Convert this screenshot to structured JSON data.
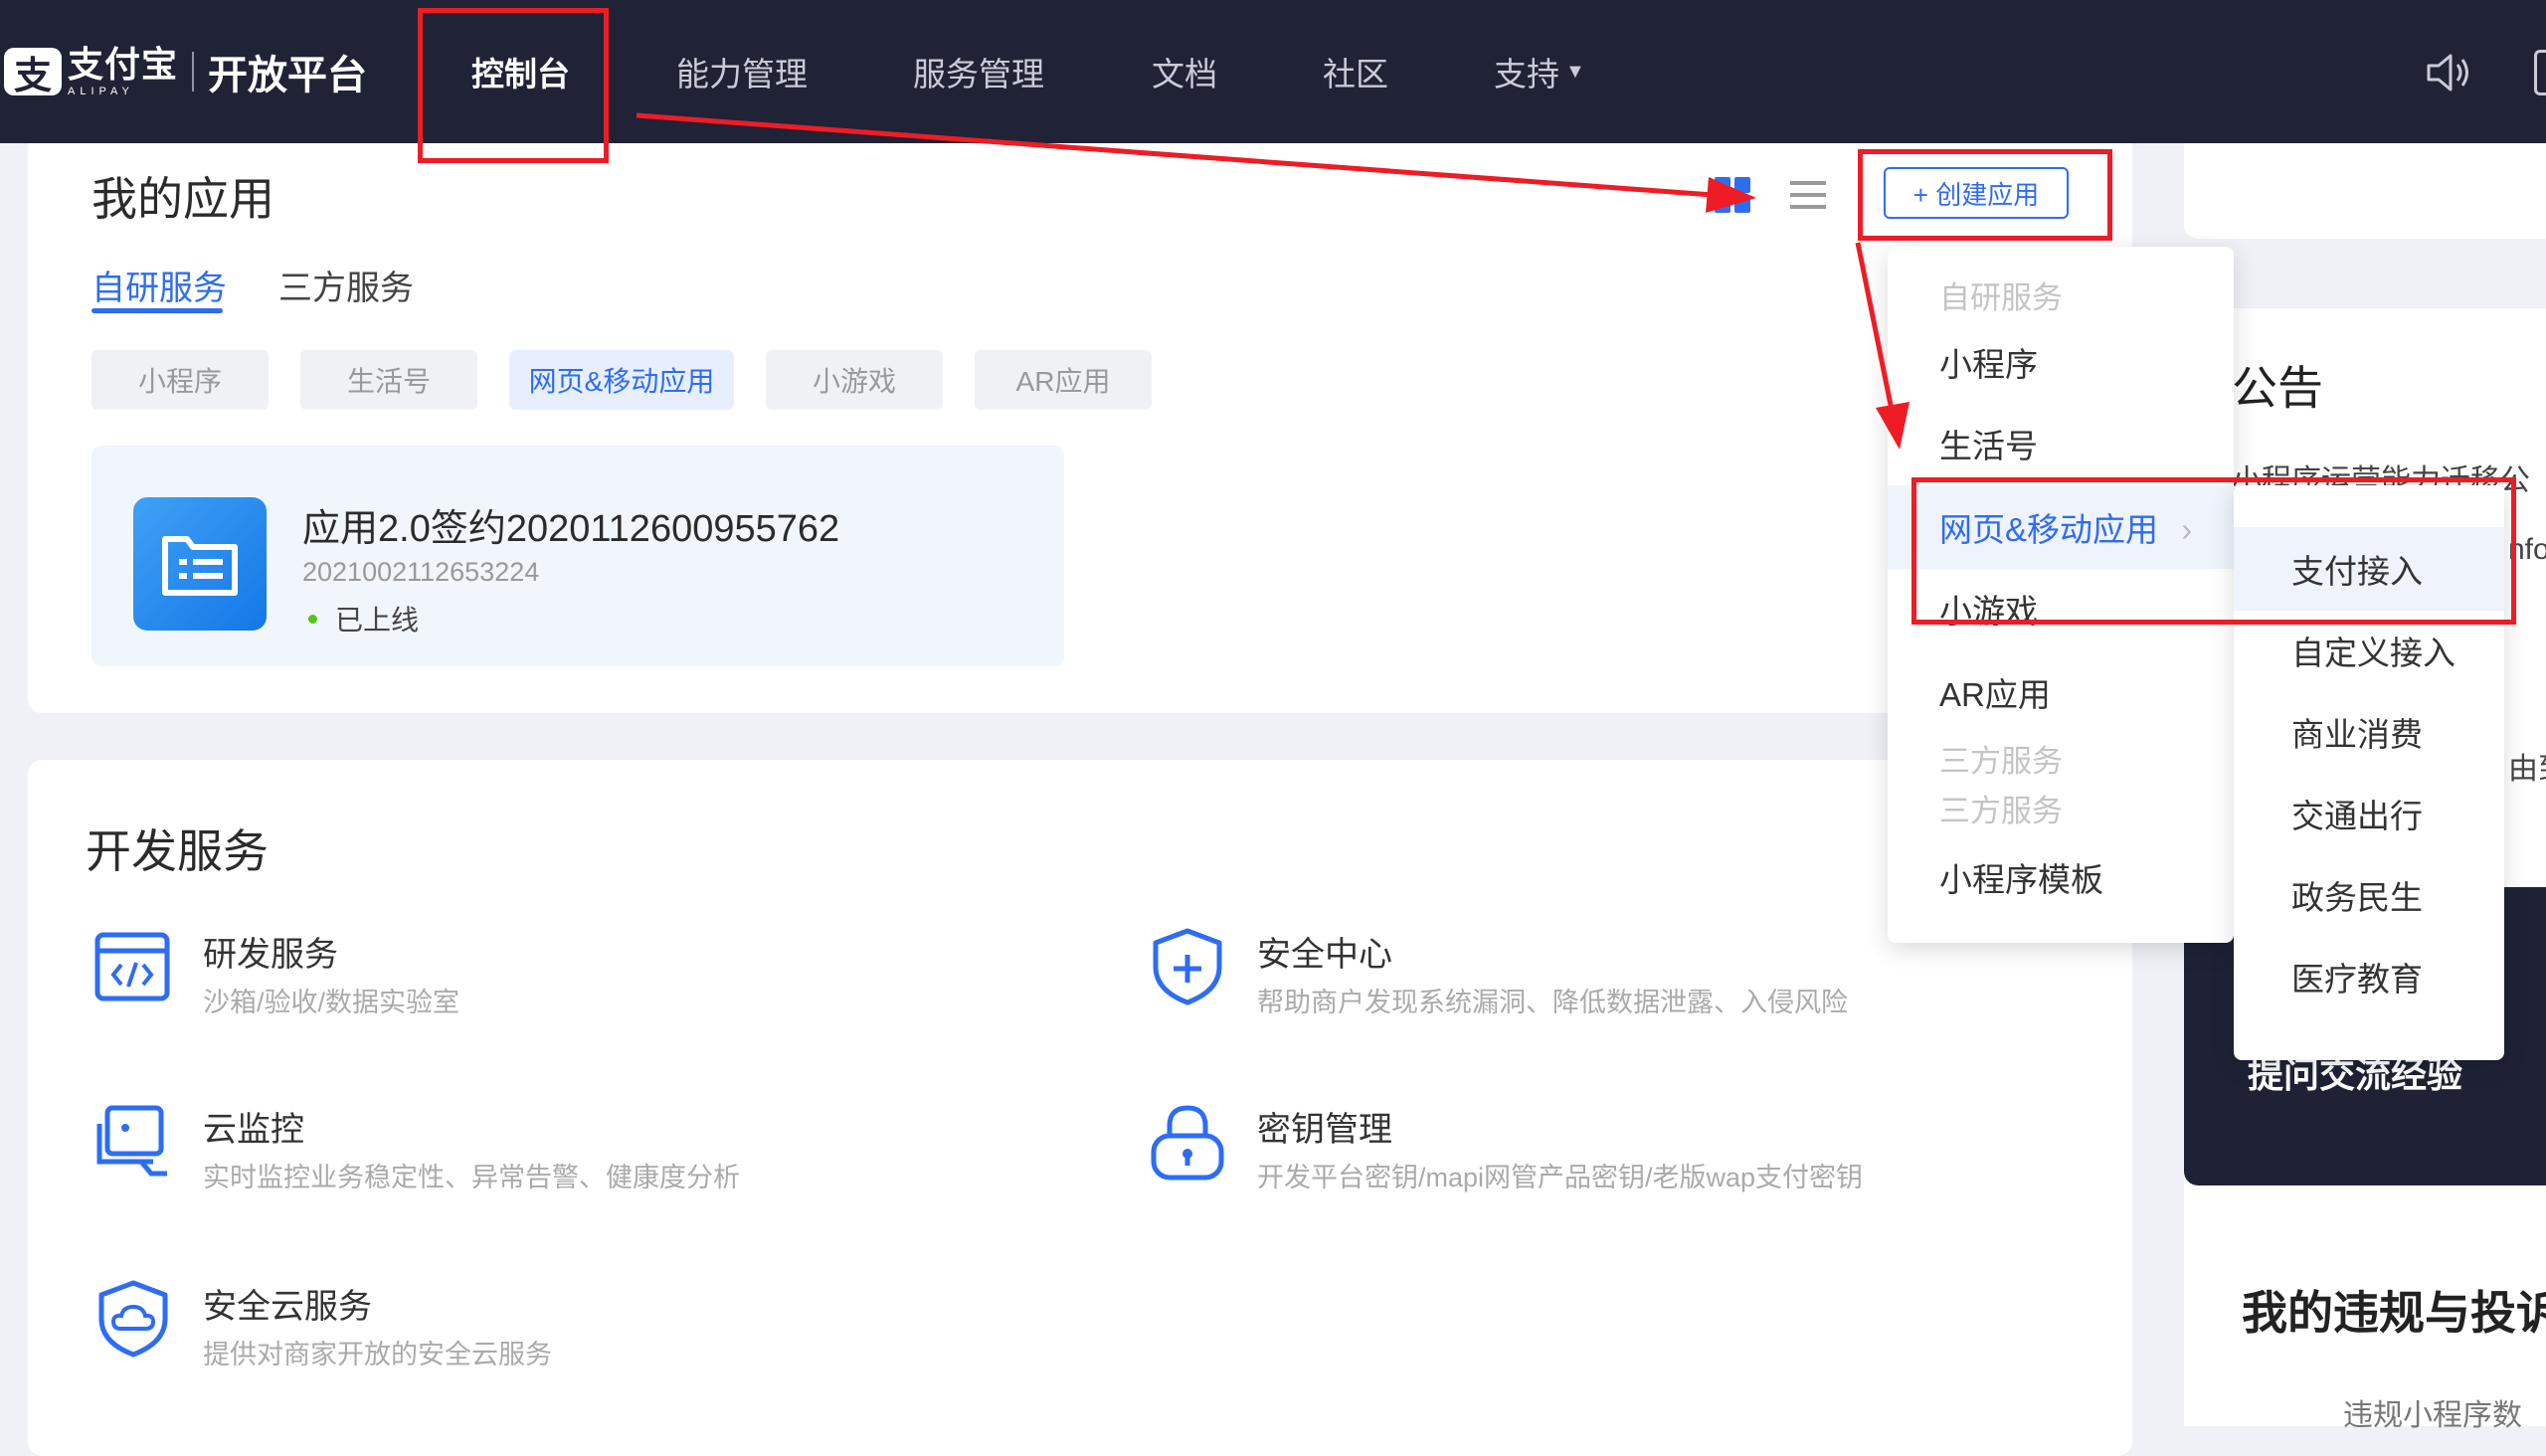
{
  "header": {
    "logo_cn": "支付宝",
    "logo_en": "ALIPAY",
    "platform": "开放平台",
    "nav": [
      "控制台",
      "能力管理",
      "服务管理",
      "文档",
      "社区",
      "支持"
    ]
  },
  "my_apps": {
    "title": "我的应用",
    "create_label": "+ 创建应用",
    "tabs": [
      "自研服务",
      "三方服务"
    ],
    "chips": [
      "小程序",
      "生活号",
      "网页&移动应用",
      "小游戏",
      "AR应用"
    ],
    "app": {
      "name": "应用2.0签约2020112600955762",
      "id": "2021002112653224",
      "status": "已上线"
    }
  },
  "dev_services": {
    "title": "开发服务",
    "items": [
      {
        "title": "研发服务",
        "desc": "沙箱/验收/数据实验室"
      },
      {
        "title": "安全中心",
        "desc": "帮助商户发现系统漏洞、降低数据泄露、入侵风险"
      },
      {
        "title": "云监控",
        "desc": "实时监控业务稳定性、异常告警、健康度分析"
      },
      {
        "title": "密钥管理",
        "desc": "开发平台密钥/mapi网管产品密钥/老版wap支付密钥"
      },
      {
        "title": "安全云服务",
        "desc": "提供对商家开放的安全云服务"
      }
    ]
  },
  "create_menu": {
    "group_self": "自研服务",
    "items": [
      "小程序",
      "生活号",
      "网页&移动应用",
      "小游戏",
      "AR应用"
    ],
    "group_third_1": "三方服务",
    "group_third_2": "三方服务",
    "template": "小程序模板"
  },
  "sub_menu": [
    "支付接入",
    "自定义接入",
    "商业消费",
    "交通出行",
    "政务民生",
    "医疗教育"
  ],
  "sidebar": {
    "notice_title": "公告",
    "notice_line1": "小程序运营能力迁移公",
    "notice_line2": "nfo",
    "notice_line3": "由到",
    "dark_card_text": "提问交流经验",
    "violation_title": "我的违规与投诉",
    "violation_sub": "违规小程序数"
  },
  "colors": {
    "accent": "#2e6cf6",
    "annotation": "#ee1c25",
    "nav_bg": "#202235"
  }
}
